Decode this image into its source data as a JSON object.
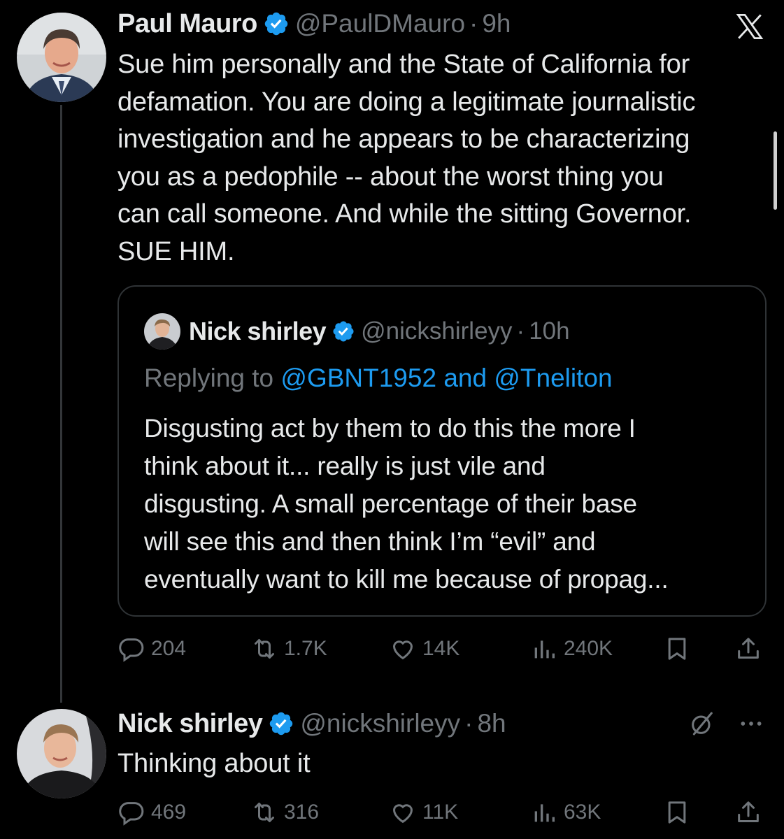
{
  "app": {
    "brand": "X"
  },
  "colors": {
    "background": "#000000",
    "text": "#e7e9ea",
    "muted": "#71767b",
    "accent": "#1d9bf0",
    "border": "#2f3336"
  },
  "main_tweet": {
    "author_name": "Paul Mauro",
    "handle": "@PaulDMauro",
    "separator": "·",
    "time": "9h",
    "text_lines": [
      "Sue him personally and the State of California for",
      "defamation. You are doing a legitimate journalistic",
      "investigation and he appears to be characterizing",
      "you as a pedophile -- about the worst thing you",
      "can call someone. And while the sitting Governor.",
      "SUE HIM."
    ],
    "quote": {
      "author_name": "Nick shirley",
      "handle": "@nickshirleyy",
      "separator": "·",
      "time": "10h",
      "replying_prefix": "Replying to ",
      "mention_1": "@GBNT1952",
      "mention_joiner": " and ",
      "mention_2": "@Tneliton",
      "text_lines": [
        "Disgusting act by them to do this the more I",
        "think about it... really is just vile and",
        "disgusting. A small percentage of their base",
        "will see this and then think I’m “evil” and",
        "eventually want to kill me because of propag..."
      ]
    },
    "stats": {
      "replies": "204",
      "reposts": "1.7K",
      "likes": "14K",
      "views": "240K"
    }
  },
  "reply_tweet": {
    "author_name": "Nick shirley",
    "handle": "@nickshirleyy",
    "separator": "·",
    "time": "8h",
    "text": "Thinking about it",
    "stats": {
      "replies": "469",
      "reposts": "316",
      "likes": "11K",
      "views": "63K"
    }
  },
  "icons": [
    "x-logo-icon",
    "verified-badge-icon",
    "reply-icon",
    "repost-icon",
    "like-icon",
    "views-icon",
    "bookmark-icon",
    "share-icon",
    "grok-icon",
    "more-icon"
  ]
}
